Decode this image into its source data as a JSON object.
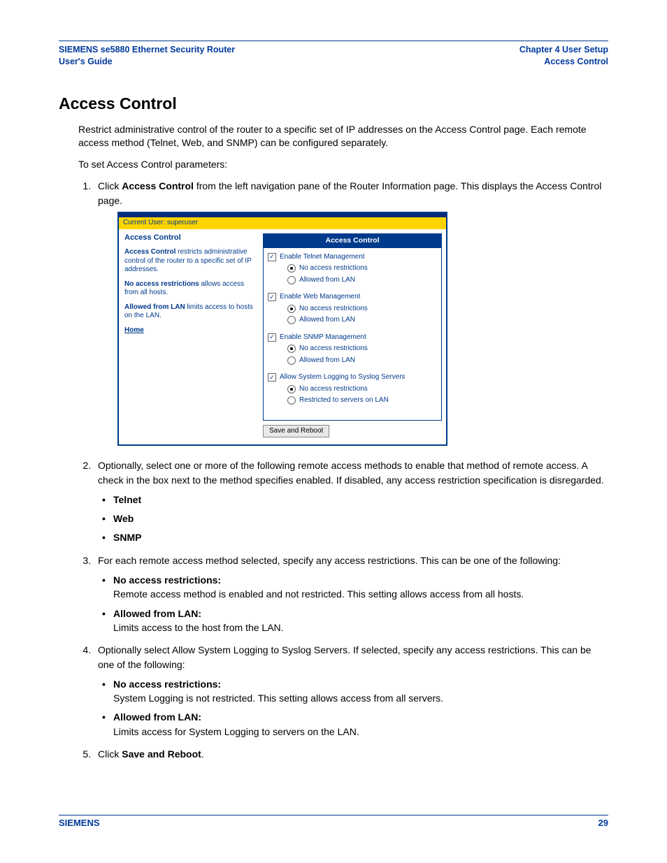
{
  "header": {
    "left_line1": "SIEMENS se5880 Ethernet Security Router",
    "left_line2": "User's Guide",
    "right_line1": "Chapter 4  User Setup",
    "right_line2": "Access Control"
  },
  "title": "Access Control",
  "intro1": "Restrict administrative control of the router to a specific set of IP addresses on the Access Control page. Each remote access method (Telnet, Web, and SNMP) can be configured separately.",
  "intro2": "To set Access Control parameters:",
  "step1a": "Click ",
  "step1b": "Access Control",
  "step1c": " from the left navigation pane of the Router Information page. This displays the Access Control page.",
  "step2": "Optionally, select one or more of the following remote access methods to enable that method of remote access. A check in the box next to the method specifies enabled. If disabled, any access restriction specification is disregarded.",
  "step2_items": [
    "Telnet",
    "Web",
    "SNMP"
  ],
  "step3": "For each remote access method selected, specify any access restrictions. This can be one of the following:",
  "step3_items": [
    {
      "label": "No access restrictions:",
      "desc": "Remote access method is enabled and not restricted. This setting allows access from all hosts."
    },
    {
      "label": "Allowed from LAN:",
      "desc": "Limits access to the host from the LAN."
    }
  ],
  "step4": "Optionally select Allow System Logging to Syslog Servers. If selected, specify any access restrictions. This can be one of the following:",
  "step4_items": [
    {
      "label": "No access restrictions:",
      "desc": "System Logging is not restricted. This setting allows access from all servers."
    },
    {
      "label": "Allowed from LAN:",
      "desc": "Limits access for System Logging to servers on the LAN."
    }
  ],
  "step5a": "Click ",
  "step5b": "Save and Reboot",
  "step5c": ".",
  "figure": {
    "user_bar": "Current User: superuser",
    "side_title": "Access Control",
    "side_p1a": "Access Control",
    "side_p1b": " restricts administrative control of the router to a specific set of IP addresses.",
    "side_p2a": "No access restrictions",
    "side_p2b": " allows access from all hosts.",
    "side_p3a": "Allowed from LAN",
    "side_p3b": " limits access to hosts on the LAN.",
    "home": "Home",
    "panel_title": "Access Control",
    "groups": [
      {
        "cb": "Enable Telnet Management",
        "r1": "No access restrictions",
        "r2": "Allowed from LAN"
      },
      {
        "cb": "Enable Web Management",
        "r1": "No access restrictions",
        "r2": "Allowed from LAN"
      },
      {
        "cb": "Enable SNMP Management",
        "r1": "No access restrictions",
        "r2": "Allowed from LAN"
      },
      {
        "cb": "Allow System Logging to Syslog Servers",
        "r1": "No access restrictions",
        "r2": "Restricted to servers on LAN"
      }
    ],
    "button": "Save and Reboot"
  },
  "footer": {
    "left": "SIEMENS",
    "right": "29"
  }
}
